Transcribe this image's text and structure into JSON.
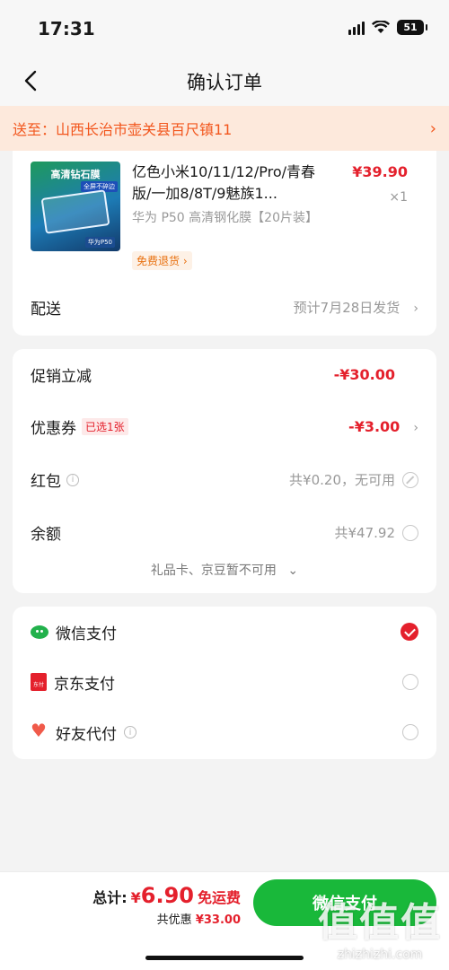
{
  "status_bar": {
    "time": "17:31",
    "battery": "51"
  },
  "nav": {
    "title": "确认订单"
  },
  "address": {
    "text": "送至：山西长治市壶关县百尺镇11"
  },
  "product": {
    "image_title": "高清钻石膜",
    "image_badge": "全屏不碎边",
    "image_tag": "华为P50",
    "name": "亿色小米10/11/12/Pro/青春版/一加8/8T/9魅族1...",
    "price": "¥39.90",
    "quantity": "×1",
    "spec": "华为 P50 高清钢化膜【20片装】",
    "return_tag": "免费退货 ›"
  },
  "delivery": {
    "label": "配送",
    "value": "预计7月28日发货"
  },
  "discounts": {
    "promo_label": "促销立减",
    "promo_value": "-¥30.00",
    "coupon_label": "优惠券",
    "coupon_tag": "已选1张",
    "coupon_value": "-¥3.00",
    "redpacket_label": "红包",
    "redpacket_value": "共¥0.20，无可用",
    "balance_label": "余额",
    "balance_value": "共¥47.92",
    "gift_note": "礼品卡、京豆暂不可用"
  },
  "payment": {
    "options": [
      {
        "label": "微信支付",
        "icon": "wechat-icon",
        "selected": true
      },
      {
        "label": "京东支付",
        "icon": "jd-icon",
        "selected": false
      },
      {
        "label": "好友代付",
        "icon": "friend-pay-icon",
        "selected": false
      }
    ],
    "jd_icon_text": "东付"
  },
  "footer": {
    "total_label": "总计:",
    "currency": "¥",
    "total_amount": "6.90",
    "free_shipping": "免运费",
    "saved_label": "共优惠",
    "saved_amount": "¥33.00",
    "pay_button": "微信支付"
  },
  "watermark": {
    "logo": "值值值",
    "url": "zhizhizhi.com"
  },
  "colors": {
    "accent_red": "#e4202c",
    "pay_green": "#19b83a",
    "address_orange": "#f2561d"
  }
}
